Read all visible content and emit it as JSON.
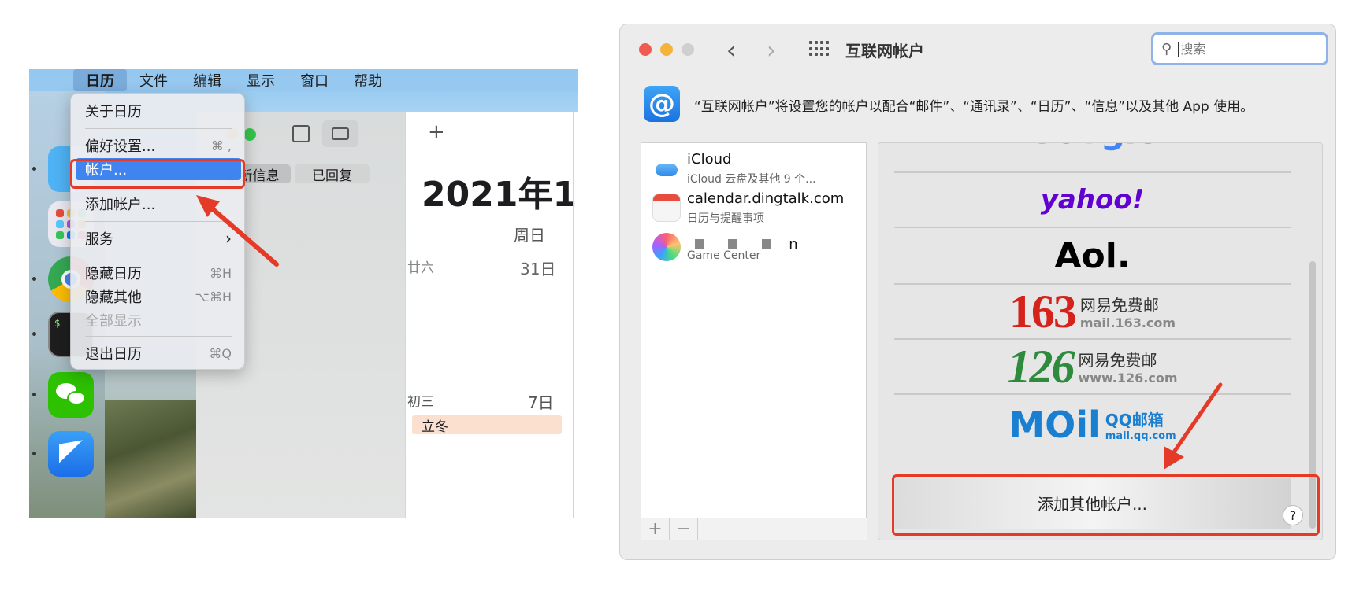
{
  "calendar_app": {
    "menubar": {
      "apple_icon": "apple-logo-icon",
      "items": [
        "日历",
        "文件",
        "编辑",
        "显示",
        "窗口",
        "帮助"
      ],
      "active": "日历"
    },
    "app_menu": {
      "about": "关于日历",
      "preferences": {
        "label": "偏好设置...",
        "shortcut": "⌘ ,"
      },
      "accounts": "帐户...",
      "add_account": "添加帐户...",
      "services": "服务",
      "hide": {
        "label": "隐藏日历",
        "shortcut": "⌘H"
      },
      "hide_others": {
        "label": "隐藏其他",
        "shortcut": "⌥⌘H"
      },
      "show_all": "全部显示",
      "quit": {
        "label": "退出日历",
        "shortcut": "⌘Q"
      }
    },
    "toolbar": {
      "segment_new": "新信息",
      "segment_replied": "已回复",
      "add_label": "+"
    },
    "main": {
      "title": "2021年1",
      "weekday": "周日",
      "rows": [
        {
          "lunar": "廿六",
          "date": "31日"
        },
        {
          "lunar": "初三",
          "date": "7日",
          "event": "立冬"
        }
      ]
    }
  },
  "internet_accounts": {
    "window_title": "互联网帐户",
    "search_placeholder": "搜索",
    "description": "“互联网帐户”将设置您的帐户以配合“邮件”、“通讯录”、“日历”、“信息”以及其他 App 使用。",
    "accounts": [
      {
        "name": "iCloud",
        "detail": "iCloud 云盘及其他 9 个..."
      },
      {
        "name": "calendar.dingtalk.com",
        "detail": "日历与提醒事项"
      },
      {
        "name": "n",
        "detail": "Game Center"
      }
    ],
    "list_buttons": {
      "add": "+",
      "remove": "−"
    },
    "providers": {
      "google": "Google",
      "yahoo": "yahoo!",
      "aol": "Aol.",
      "p163": {
        "num": "163",
        "cn": "网易免费邮",
        "domain": "mail.163.com"
      },
      "p126": {
        "num": "126",
        "cn": "网易免费邮",
        "domain": "www.126.com"
      },
      "qq": {
        "mark": "MOil",
        "cn": "QQ邮箱",
        "domain": "mail.qq.com"
      }
    },
    "add_other": "添加其他帐户...",
    "help": "?"
  },
  "colors": {
    "highlight_blue": "#3f84ef",
    "annotation_red": "#e53a27"
  }
}
